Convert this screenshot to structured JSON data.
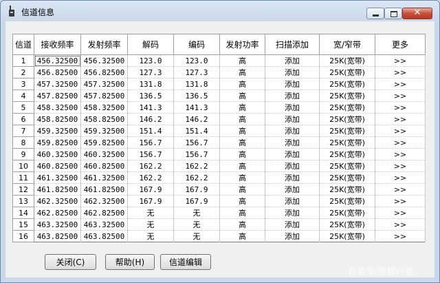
{
  "window": {
    "title": "信道信息",
    "close_glyph": "✕"
  },
  "table": {
    "headers": [
      "信道",
      "接收频率",
      "发射频率",
      "解码",
      "编码",
      "发射功率",
      "扫描添加",
      "宽/窄带",
      "更多"
    ],
    "rows": [
      [
        "1",
        "456.32500",
        "456.32500",
        "123.0",
        "123.0",
        "高",
        "添加",
        "25K(宽带)",
        ">>"
      ],
      [
        "2",
        "456.82500",
        "456.82500",
        "127.3",
        "127.3",
        "高",
        "添加",
        "25K(宽带)",
        ">>"
      ],
      [
        "3",
        "457.32500",
        "457.32500",
        "131.8",
        "131.8",
        "高",
        "添加",
        "25K(宽带)",
        ">>"
      ],
      [
        "4",
        "457.82500",
        "457.82500",
        "136.5",
        "136.5",
        "高",
        "添加",
        "25K(宽带)",
        ">>"
      ],
      [
        "5",
        "458.32500",
        "458.32500",
        "141.3",
        "141.3",
        "高",
        "添加",
        "25K(宽带)",
        ">>"
      ],
      [
        "6",
        "458.82500",
        "458.82500",
        "146.2",
        "146.2",
        "高",
        "添加",
        "25K(宽带)",
        ">>"
      ],
      [
        "7",
        "459.32500",
        "459.32500",
        "151.4",
        "151.4",
        "高",
        "添加",
        "25K(宽带)",
        ">>"
      ],
      [
        "8",
        "459.82500",
        "459.82500",
        "156.7",
        "156.7",
        "高",
        "添加",
        "25K(宽带)",
        ">>"
      ],
      [
        "9",
        "460.32500",
        "460.32500",
        "156.7",
        "156.7",
        "高",
        "添加",
        "25K(宽带)",
        ">>"
      ],
      [
        "10",
        "460.82500",
        "460.82500",
        "162.2",
        "162.2",
        "高",
        "添加",
        "25K(宽带)",
        ">>"
      ],
      [
        "11",
        "461.32500",
        "461.32500",
        "162.2",
        "162.2",
        "高",
        "添加",
        "25K(宽带)",
        ">>"
      ],
      [
        "12",
        "461.82500",
        "461.82500",
        "167.9",
        "167.9",
        "高",
        "添加",
        "25K(宽带)",
        ">>"
      ],
      [
        "13",
        "462.32500",
        "462.32500",
        "167.9",
        "167.9",
        "高",
        "添加",
        "25K(宽带)",
        ">>"
      ],
      [
        "14",
        "462.82500",
        "462.82500",
        "无",
        "无",
        "高",
        "添加",
        "25K(宽带)",
        ">>"
      ],
      [
        "15",
        "463.32500",
        "463.32500",
        "无",
        "无",
        "高",
        "添加",
        "25K(宽带)",
        ">>"
      ],
      [
        "16",
        "463.82500",
        "463.82500",
        "无",
        "无",
        "高",
        "添加",
        "25K(宽带)",
        ">>"
      ]
    ]
  },
  "buttons": {
    "close": "关闭(C)",
    "help": "帮助(H)",
    "edit": "信道编辑"
  },
  "watermark": "百家号/思想行者"
}
